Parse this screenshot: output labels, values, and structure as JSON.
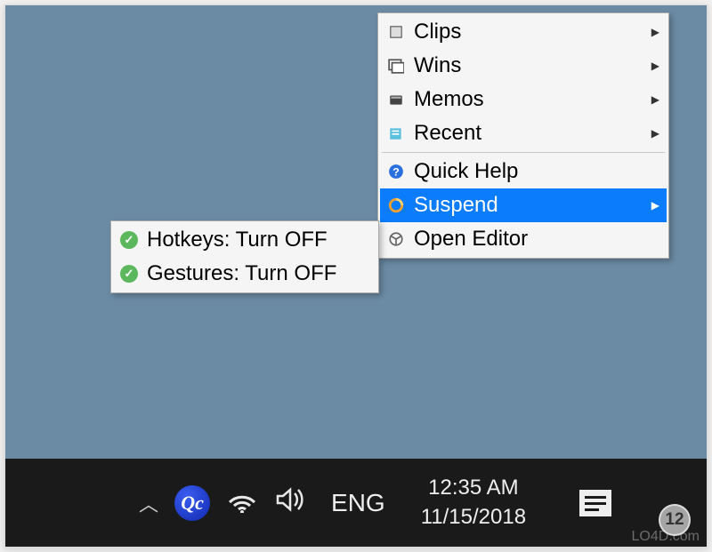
{
  "main_menu": {
    "items": [
      {
        "icon": "clips-icon",
        "label": "Clips",
        "submenu": true
      },
      {
        "icon": "wins-icon",
        "label": "Wins",
        "submenu": true
      },
      {
        "icon": "memos-icon",
        "label": "Memos",
        "submenu": true
      },
      {
        "icon": "recent-icon",
        "label": "Recent",
        "submenu": true
      }
    ],
    "items2": [
      {
        "icon": "help-icon",
        "label": "Quick Help",
        "submenu": false
      },
      {
        "icon": "suspend-icon",
        "label": "Suspend",
        "submenu": true,
        "highlight": true
      },
      {
        "icon": "editor-icon",
        "label": "Open Editor",
        "submenu": false
      }
    ]
  },
  "sub_menu": {
    "items": [
      {
        "icon": "check-icon",
        "label": "Hotkeys: Turn OFF"
      },
      {
        "icon": "check-icon",
        "label": "Gestures: Turn OFF"
      }
    ]
  },
  "taskbar": {
    "app_icon_label": "Qc",
    "language": "ENG",
    "clock_time": "12:35 AM",
    "clock_date": "11/15/2018"
  },
  "watermark": {
    "text": "LO4D.com",
    "badge": "12"
  }
}
